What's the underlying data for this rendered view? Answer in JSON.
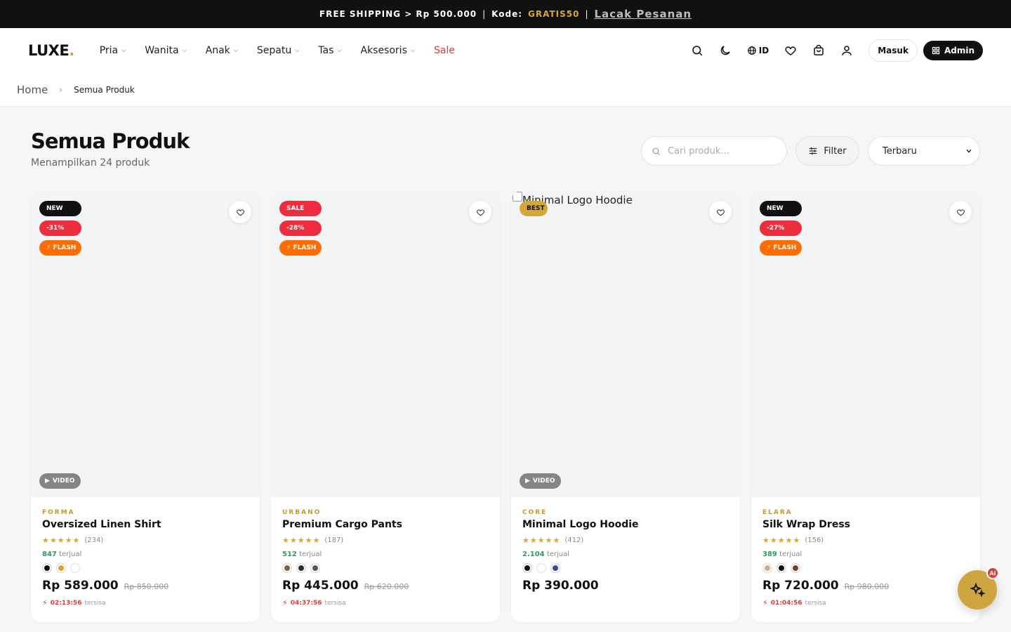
{
  "topbar": {
    "shipping_text": "FREE SHIPPING > Rp 500.000",
    "sep1": "|",
    "code_label": "Kode:",
    "code_value": "GRATIS50",
    "sep2": "|",
    "track_link": "Lacak Pesanan"
  },
  "header": {
    "logo": "LUXE",
    "logo_dot": ".",
    "nav": [
      {
        "label": "Pria",
        "dropdown": true
      },
      {
        "label": "Wanita",
        "dropdown": true
      },
      {
        "label": "Anak",
        "dropdown": true
      },
      {
        "label": "Sepatu",
        "dropdown": true
      },
      {
        "label": "Tas",
        "dropdown": true
      },
      {
        "label": "Aksesoris",
        "dropdown": true
      },
      {
        "label": "Sale",
        "dropdown": false
      }
    ],
    "lang": "ID",
    "login_label": "Masuk",
    "admin_label": "Admin"
  },
  "breadcrumb": {
    "home": "Home",
    "separator": "›",
    "current": "Semua Produk"
  },
  "page": {
    "title": "Semua Produk",
    "subtitle": "Menampilkan 24 produk",
    "search_placeholder": "Cari produk...",
    "filter_label": "Filter",
    "sort_selected": "Terbaru"
  },
  "products": [
    {
      "badges": [
        {
          "type": "new",
          "label": "NEW"
        },
        {
          "type": "disc",
          "label": "-31%"
        },
        {
          "type": "flash",
          "label": "FLASH"
        }
      ],
      "video_label": "VIDEO",
      "brand": "FORMA",
      "name": "Oversized Linen Shirt",
      "stars": "★★★★★",
      "reviews": "(234)",
      "sold_count": "847",
      "sold_label": "terjual",
      "swatches": [
        "#111111",
        "#d4a838",
        "#ffffff"
      ],
      "price": "Rp 589.000",
      "old_price": "Rp 850.000",
      "timer": "02:13:56",
      "timer_label": "tersisa"
    },
    {
      "badges": [
        {
          "type": "sale",
          "label": "SALE"
        },
        {
          "type": "disc",
          "label": "-28%"
        },
        {
          "type": "flash",
          "label": "FLASH"
        }
      ],
      "video_label": "",
      "brand": "URBANO",
      "name": "Premium Cargo Pants",
      "stars": "★★★★★",
      "reviews": "(187)",
      "sold_count": "512",
      "sold_label": "terjual",
      "swatches": [
        "#7a6446",
        "#2b2b2b",
        "#555555"
      ],
      "price": "Rp 445.000",
      "old_price": "Rp 620.000",
      "timer": "04:37:56",
      "timer_label": "tersisa"
    },
    {
      "badges": [
        {
          "type": "best",
          "label": "BEST"
        }
      ],
      "alt_text": "Minimal Logo Hoodie",
      "video_label": "VIDEO",
      "brand": "CORE",
      "name": "Minimal Logo Hoodie",
      "stars": "★★★★★",
      "reviews": "(412)",
      "sold_count": "2.104",
      "sold_label": "terjual",
      "swatches": [
        "#111111",
        "#ffffff",
        "#3b4a8a"
      ],
      "price": "Rp 390.000",
      "old_price": "",
      "timer": "",
      "timer_label": ""
    },
    {
      "badges": [
        {
          "type": "new",
          "label": "NEW"
        },
        {
          "type": "disc",
          "label": "-27%"
        },
        {
          "type": "flash",
          "label": "FLASH"
        }
      ],
      "video_label": "",
      "brand": "ELARA",
      "name": "Silk Wrap Dress",
      "stars": "★★★★★",
      "reviews": "(156)",
      "sold_count": "389",
      "sold_label": "terjual",
      "swatches": [
        "#c8b08a",
        "#111111",
        "#7a3b2e"
      ],
      "price": "Rp 720.000",
      "old_price": "Rp 980.000",
      "timer": "01:04:56",
      "timer_label": "tersisa"
    }
  ],
  "ai_button": {
    "tag": "AI"
  },
  "colors": {
    "accent": "#d4a838",
    "sale": "#e53935",
    "badge_red": "#ef2d3f",
    "flash": "#ff6d00",
    "sold_green": "#22a35a"
  }
}
